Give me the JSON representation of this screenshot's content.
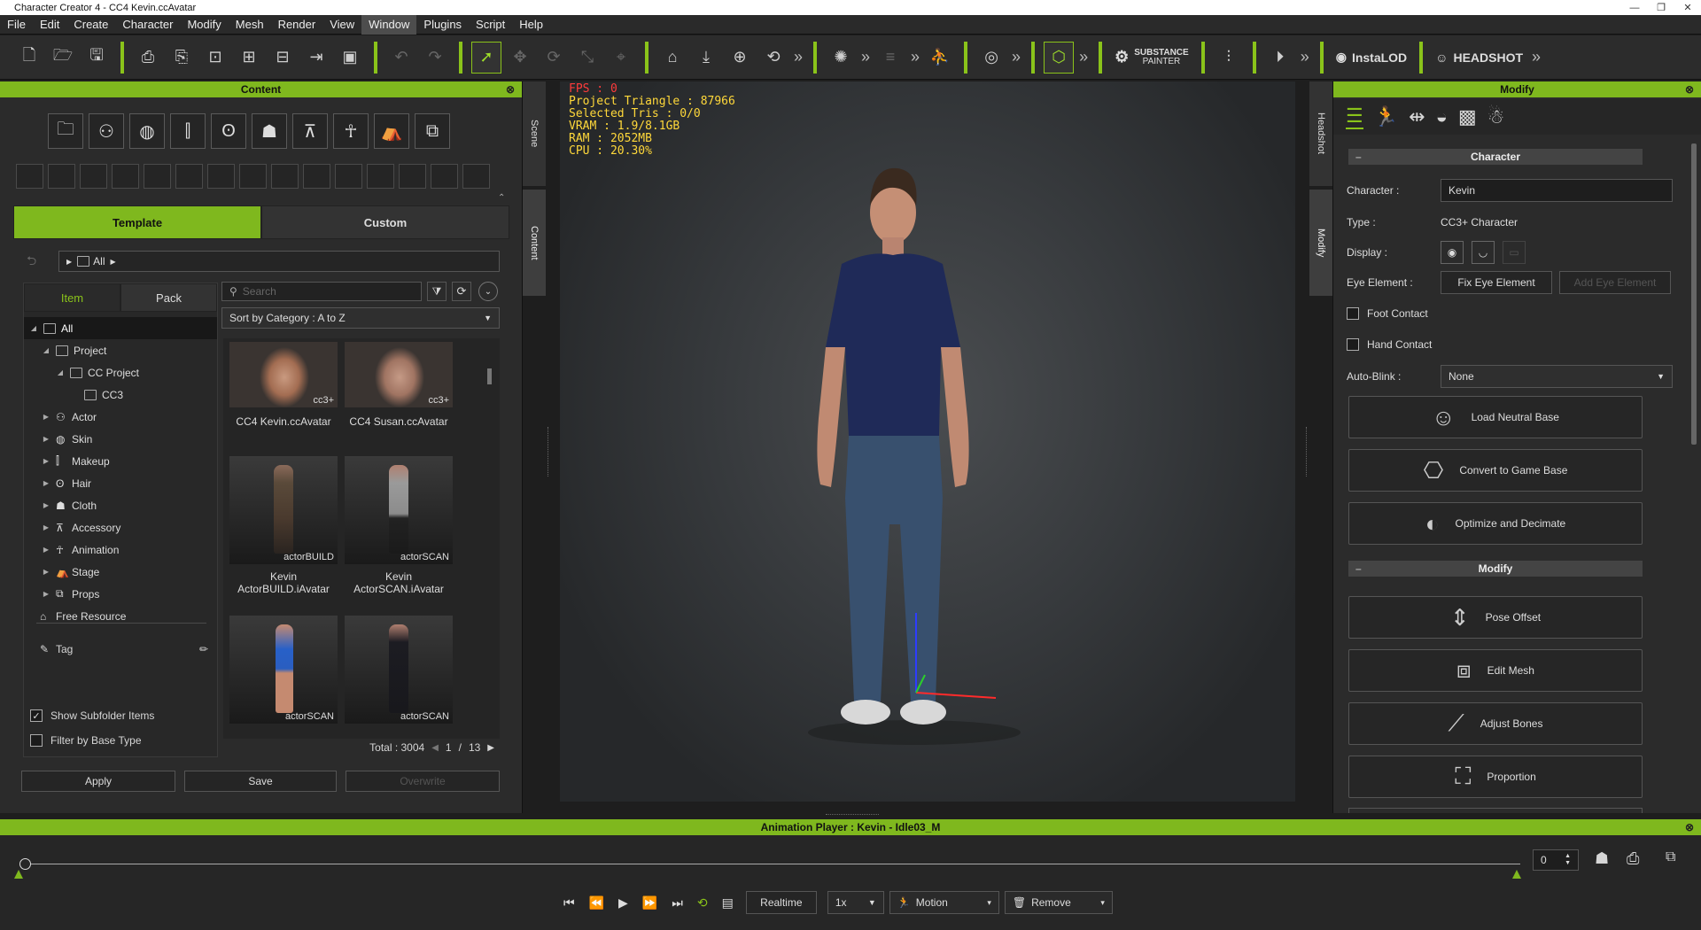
{
  "window": {
    "title": "Character Creator 4 - CC4 Kevin.ccAvatar",
    "controls": [
      "—",
      "❐",
      "✕"
    ]
  },
  "menu": [
    "File",
    "Edit",
    "Create",
    "Character",
    "Modify",
    "Mesh",
    "Render",
    "View",
    "Window",
    "Plugins",
    "Script",
    "Help"
  ],
  "menu_active": "Window",
  "toolbar": {
    "substance_label": "SUBSTANCE",
    "substance_sub": "PAINTER",
    "instalod_label": "InstaLOD",
    "headshot_label": "HEADSHOT",
    "more_glyph": "»",
    "accent": "#7fb81e"
  },
  "content_panel": {
    "title": "Content",
    "tabs": [
      "Template",
      "Custom"
    ],
    "active_tab": "Template",
    "path_label": "All",
    "subtabs": [
      "Item",
      "Pack"
    ],
    "active_subtab": "Item",
    "search_placeholder": "Search",
    "sort_label": "Sort by Category : A to Z",
    "tree": [
      {
        "label": "All",
        "level": 0,
        "expanded": true,
        "selected": true
      },
      {
        "label": "Project",
        "level": 1,
        "expanded": true
      },
      {
        "label": "CC Project",
        "level": 2,
        "expanded": true
      },
      {
        "label": "CC3",
        "level": 3
      },
      {
        "label": "Actor",
        "level": 1
      },
      {
        "label": "Skin",
        "level": 1
      },
      {
        "label": "Makeup",
        "level": 1
      },
      {
        "label": "Hair",
        "level": 1
      },
      {
        "label": "Cloth",
        "level": 1
      },
      {
        "label": "Accessory",
        "level": 1
      },
      {
        "label": "Animation",
        "level": 1
      },
      {
        "label": "Stage",
        "level": 1
      },
      {
        "label": "Props",
        "level": 1
      }
    ],
    "free_resource_label": "Free Resource",
    "tag_label": "Tag",
    "show_subfolder_label": "Show Subfolder Items",
    "show_subfolder_checked": true,
    "filter_base_label": "Filter by Base Type",
    "filter_base_checked": false,
    "buttons": [
      "Apply",
      "Save",
      "Overwrite"
    ],
    "items": [
      {
        "name": "CC4 Kevin.ccAvatar",
        "watermark": "cc3+"
      },
      {
        "name": "CC4 Susan.ccAvatar",
        "watermark": "cc3+"
      },
      {
        "name": "Kevin ActorBUILD.iAvatar",
        "watermark": "actorBUILD"
      },
      {
        "name": "Kevin ActorSCAN.iAvatar",
        "watermark": "actorSCAN"
      },
      {
        "name": "",
        "watermark": "actorSCAN"
      },
      {
        "name": "",
        "watermark": "actorSCAN"
      }
    ],
    "total_label": "Total : 3004",
    "page": "1",
    "page_sep": "/",
    "pages": "13"
  },
  "side_tabs_left": [
    "Scene",
    "Content"
  ],
  "side_tabs_right": [
    "Headshot",
    "Modify"
  ],
  "viewport": {
    "stats": [
      {
        "text": "FPS : 0",
        "color": "#ff3b3b"
      },
      {
        "text": "Project Triangle : 87966",
        "color": "#ffd83a"
      },
      {
        "text": "Selected Tris : 0/0",
        "color": "#ffd83a"
      },
      {
        "text": "VRAM : 1.9/8.1GB",
        "color": "#ffd83a"
      },
      {
        "text": "RAM : 2052MB",
        "color": "#ffd83a"
      },
      {
        "text": "CPU : 20.30%",
        "color": "#ffd83a"
      }
    ]
  },
  "modify_panel": {
    "title": "Modify",
    "character_section": "Character",
    "character_label": "Character :",
    "character_value": "Kevin",
    "type_label": "Type :",
    "type_value": "CC3+ Character",
    "display_label": "Display :",
    "eye_label": "Eye Element :",
    "fix_eye_label": "Fix Eye Element",
    "add_eye_label": "Add Eye Element",
    "foot_contact_label": "Foot Contact",
    "hand_contact_label": "Hand Contact",
    "autoblink_label": "Auto-Blink :",
    "autoblink_value": "None",
    "actions": [
      "Load Neutral Base",
      "Convert to Game Base",
      "Optimize and Decimate"
    ],
    "modify_section": "Modify",
    "modify_actions": [
      "Pose Offset",
      "Edit Mesh",
      "Adjust Bones",
      "Proportion"
    ]
  },
  "animation_player": {
    "title": "Animation Player : Kevin - Idle03_M",
    "frame_value": "0",
    "realtime_label": "Realtime",
    "speed_value": "1x",
    "motion_label": "Motion",
    "remove_label": "Remove"
  }
}
